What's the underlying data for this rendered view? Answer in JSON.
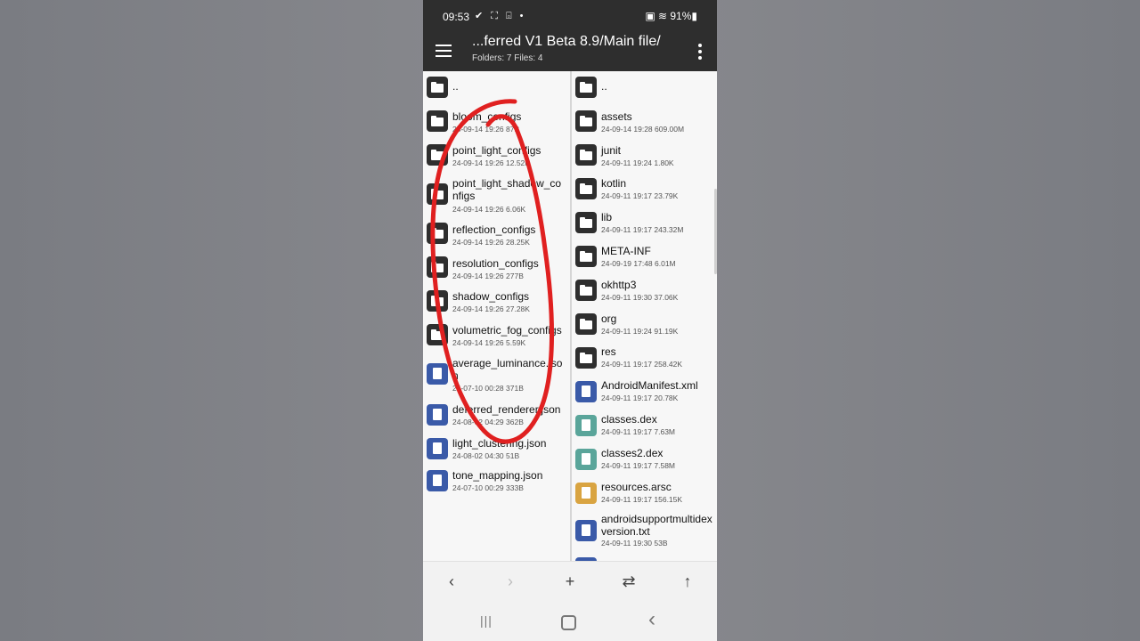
{
  "status": {
    "time": "09:53",
    "icons": "✔ ⛶ ⌻ •",
    "right": "▣ ≋ 91%▮"
  },
  "appbar": {
    "title": "...ferred V1 Beta 8.9/Main file/",
    "subtitle": "Folders: 7  Files: 4"
  },
  "left_pane": [
    {
      "name": "..",
      "meta": "",
      "type": "folder"
    },
    {
      "name": "bloom_configs",
      "meta": "24-09-14 19:26  87B",
      "type": "folder"
    },
    {
      "name": "point_light_configs",
      "meta": "24-09-14 19:26  12.52K",
      "type": "folder"
    },
    {
      "name": "point_light_shadow_configs",
      "meta": "24-09-14 19:26  6.06K",
      "type": "folder"
    },
    {
      "name": "reflection_configs",
      "meta": "24-09-14 19:26  28.25K",
      "type": "folder"
    },
    {
      "name": "resolution_configs",
      "meta": "24-09-14 19:26  277B",
      "type": "folder"
    },
    {
      "name": "shadow_configs",
      "meta": "24-09-14 19:26  27.28K",
      "type": "folder"
    },
    {
      "name": "volumetric_fog_configs",
      "meta": "24-09-14 19:26  5.59K",
      "type": "folder"
    },
    {
      "name": "average_luminance.json",
      "meta": "24-07-10 00:28  371B",
      "type": "doc"
    },
    {
      "name": "deferred_renderer.json",
      "meta": "24-08-02 04:29  362B",
      "type": "doc"
    },
    {
      "name": "light_clustering.json",
      "meta": "24-08-02 04:30  51B",
      "type": "doc"
    },
    {
      "name": "tone_mapping.json",
      "meta": "24-07-10 00:29  333B",
      "type": "doc"
    }
  ],
  "right_pane": [
    {
      "name": "..",
      "meta": "",
      "type": "folder"
    },
    {
      "name": "assets",
      "meta": "24-09-14 19:28  609.00M",
      "type": "folder"
    },
    {
      "name": "junit",
      "meta": "24-09-11 19:24  1.80K",
      "type": "folder"
    },
    {
      "name": "kotlin",
      "meta": "24-09-11 19:17  23.79K",
      "type": "folder"
    },
    {
      "name": "lib",
      "meta": "24-09-11 19:17  243.32M",
      "type": "folder"
    },
    {
      "name": "META-INF",
      "meta": "24-09-19 17:48  6.01M",
      "type": "folder"
    },
    {
      "name": "okhttp3",
      "meta": "24-09-11 19:30  37.06K",
      "type": "folder"
    },
    {
      "name": "org",
      "meta": "24-09-11 19:24  91.19K",
      "type": "folder"
    },
    {
      "name": "res",
      "meta": "24-09-11 19:17  258.42K",
      "type": "folder"
    },
    {
      "name": "AndroidManifest.xml",
      "meta": "24-09-11 19:17  20.78K",
      "type": "doc"
    },
    {
      "name": "classes.dex",
      "meta": "24-09-11 19:17  7.63M",
      "type": "dex"
    },
    {
      "name": "classes2.dex",
      "meta": "24-09-11 19:17  7.58M",
      "type": "dex"
    },
    {
      "name": "resources.arsc",
      "meta": "24-09-11 19:17  156.15K",
      "type": "arsc"
    },
    {
      "name": "androidsupportmultidexversion.txt",
      "meta": "24-09-11 19:30  53B",
      "type": "doc"
    }
  ],
  "toolbar": {
    "back": "‹",
    "forward": "›",
    "add": "+",
    "swap": "⇄",
    "up": "↑"
  },
  "navbar": {
    "recents": "|||",
    "back": "‹"
  },
  "colors": {
    "appbar": "#2e2e2e",
    "folder_icon": "#2e2e2e",
    "doc_icon": "#3a5aa8",
    "dex_icon": "#5aa59a",
    "arsc_icon": "#d9a441",
    "annotation": "#e02020"
  }
}
